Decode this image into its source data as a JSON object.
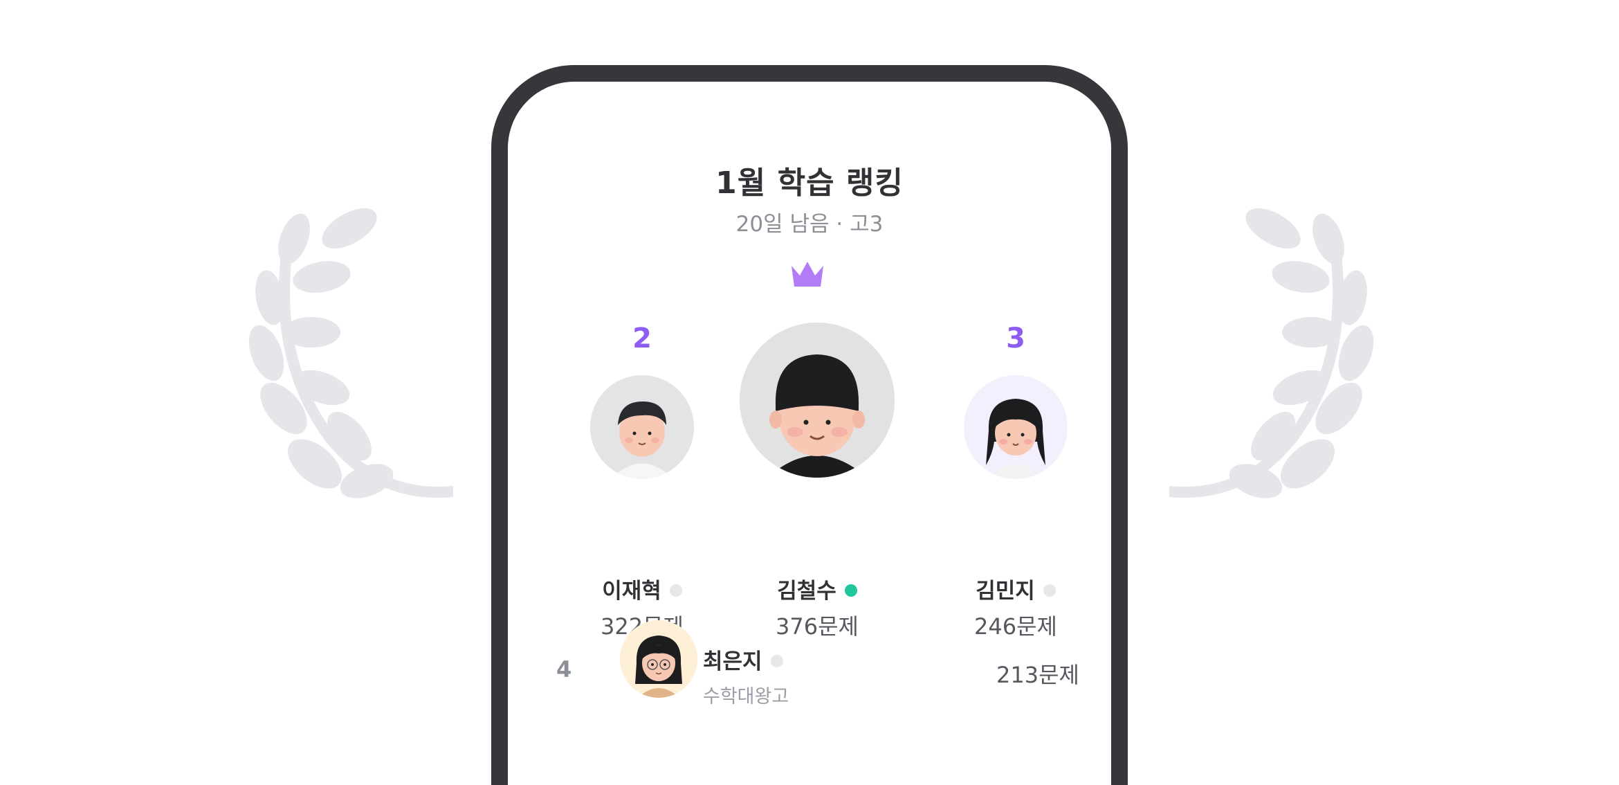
{
  "header": {
    "title": "1월 학습 랭킹",
    "subtitle": "20일 남음 · 고3"
  },
  "colors": {
    "accent": "#8e5cf2",
    "online": "#22c69c",
    "offline": "#e6e7e9",
    "laurel": "#e5e6ea"
  },
  "podium": {
    "first": {
      "name": "김철수",
      "score": "376문제",
      "status": "online",
      "icon": "crown-icon"
    },
    "second": {
      "rank": "2",
      "name": "이재혁",
      "score": "322문제",
      "status": "offline"
    },
    "third": {
      "rank": "3",
      "name": "김민지",
      "score": "246문제",
      "status": "offline"
    }
  },
  "list": [
    {
      "rank": "4",
      "name": "최은지",
      "tag": "수학대왕고",
      "score": "213문제",
      "status": "offline"
    }
  ]
}
